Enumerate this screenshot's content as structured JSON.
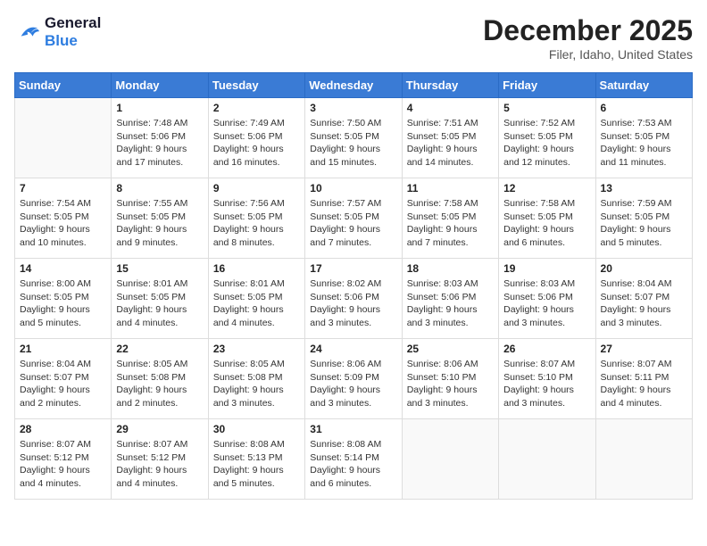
{
  "logo": {
    "line1": "General",
    "line2": "Blue"
  },
  "title": "December 2025",
  "location": "Filer, Idaho, United States",
  "weekdays": [
    "Sunday",
    "Monday",
    "Tuesday",
    "Wednesday",
    "Thursday",
    "Friday",
    "Saturday"
  ],
  "weeks": [
    [
      {
        "day": "",
        "sunrise": "",
        "sunset": "",
        "daylight": ""
      },
      {
        "day": "1",
        "sunrise": "Sunrise: 7:48 AM",
        "sunset": "Sunset: 5:06 PM",
        "daylight": "Daylight: 9 hours and 17 minutes."
      },
      {
        "day": "2",
        "sunrise": "Sunrise: 7:49 AM",
        "sunset": "Sunset: 5:06 PM",
        "daylight": "Daylight: 9 hours and 16 minutes."
      },
      {
        "day": "3",
        "sunrise": "Sunrise: 7:50 AM",
        "sunset": "Sunset: 5:05 PM",
        "daylight": "Daylight: 9 hours and 15 minutes."
      },
      {
        "day": "4",
        "sunrise": "Sunrise: 7:51 AM",
        "sunset": "Sunset: 5:05 PM",
        "daylight": "Daylight: 9 hours and 14 minutes."
      },
      {
        "day": "5",
        "sunrise": "Sunrise: 7:52 AM",
        "sunset": "Sunset: 5:05 PM",
        "daylight": "Daylight: 9 hours and 12 minutes."
      },
      {
        "day": "6",
        "sunrise": "Sunrise: 7:53 AM",
        "sunset": "Sunset: 5:05 PM",
        "daylight": "Daylight: 9 hours and 11 minutes."
      }
    ],
    [
      {
        "day": "7",
        "sunrise": "Sunrise: 7:54 AM",
        "sunset": "Sunset: 5:05 PM",
        "daylight": "Daylight: 9 hours and 10 minutes."
      },
      {
        "day": "8",
        "sunrise": "Sunrise: 7:55 AM",
        "sunset": "Sunset: 5:05 PM",
        "daylight": "Daylight: 9 hours and 9 minutes."
      },
      {
        "day": "9",
        "sunrise": "Sunrise: 7:56 AM",
        "sunset": "Sunset: 5:05 PM",
        "daylight": "Daylight: 9 hours and 8 minutes."
      },
      {
        "day": "10",
        "sunrise": "Sunrise: 7:57 AM",
        "sunset": "Sunset: 5:05 PM",
        "daylight": "Daylight: 9 hours and 7 minutes."
      },
      {
        "day": "11",
        "sunrise": "Sunrise: 7:58 AM",
        "sunset": "Sunset: 5:05 PM",
        "daylight": "Daylight: 9 hours and 7 minutes."
      },
      {
        "day": "12",
        "sunrise": "Sunrise: 7:58 AM",
        "sunset": "Sunset: 5:05 PM",
        "daylight": "Daylight: 9 hours and 6 minutes."
      },
      {
        "day": "13",
        "sunrise": "Sunrise: 7:59 AM",
        "sunset": "Sunset: 5:05 PM",
        "daylight": "Daylight: 9 hours and 5 minutes."
      }
    ],
    [
      {
        "day": "14",
        "sunrise": "Sunrise: 8:00 AM",
        "sunset": "Sunset: 5:05 PM",
        "daylight": "Daylight: 9 hours and 5 minutes."
      },
      {
        "day": "15",
        "sunrise": "Sunrise: 8:01 AM",
        "sunset": "Sunset: 5:05 PM",
        "daylight": "Daylight: 9 hours and 4 minutes."
      },
      {
        "day": "16",
        "sunrise": "Sunrise: 8:01 AM",
        "sunset": "Sunset: 5:05 PM",
        "daylight": "Daylight: 9 hours and 4 minutes."
      },
      {
        "day": "17",
        "sunrise": "Sunrise: 8:02 AM",
        "sunset": "Sunset: 5:06 PM",
        "daylight": "Daylight: 9 hours and 3 minutes."
      },
      {
        "day": "18",
        "sunrise": "Sunrise: 8:03 AM",
        "sunset": "Sunset: 5:06 PM",
        "daylight": "Daylight: 9 hours and 3 minutes."
      },
      {
        "day": "19",
        "sunrise": "Sunrise: 8:03 AM",
        "sunset": "Sunset: 5:06 PM",
        "daylight": "Daylight: 9 hours and 3 minutes."
      },
      {
        "day": "20",
        "sunrise": "Sunrise: 8:04 AM",
        "sunset": "Sunset: 5:07 PM",
        "daylight": "Daylight: 9 hours and 3 minutes."
      }
    ],
    [
      {
        "day": "21",
        "sunrise": "Sunrise: 8:04 AM",
        "sunset": "Sunset: 5:07 PM",
        "daylight": "Daylight: 9 hours and 2 minutes."
      },
      {
        "day": "22",
        "sunrise": "Sunrise: 8:05 AM",
        "sunset": "Sunset: 5:08 PM",
        "daylight": "Daylight: 9 hours and 2 minutes."
      },
      {
        "day": "23",
        "sunrise": "Sunrise: 8:05 AM",
        "sunset": "Sunset: 5:08 PM",
        "daylight": "Daylight: 9 hours and 3 minutes."
      },
      {
        "day": "24",
        "sunrise": "Sunrise: 8:06 AM",
        "sunset": "Sunset: 5:09 PM",
        "daylight": "Daylight: 9 hours and 3 minutes."
      },
      {
        "day": "25",
        "sunrise": "Sunrise: 8:06 AM",
        "sunset": "Sunset: 5:10 PM",
        "daylight": "Daylight: 9 hours and 3 minutes."
      },
      {
        "day": "26",
        "sunrise": "Sunrise: 8:07 AM",
        "sunset": "Sunset: 5:10 PM",
        "daylight": "Daylight: 9 hours and 3 minutes."
      },
      {
        "day": "27",
        "sunrise": "Sunrise: 8:07 AM",
        "sunset": "Sunset: 5:11 PM",
        "daylight": "Daylight: 9 hours and 4 minutes."
      }
    ],
    [
      {
        "day": "28",
        "sunrise": "Sunrise: 8:07 AM",
        "sunset": "Sunset: 5:12 PM",
        "daylight": "Daylight: 9 hours and 4 minutes."
      },
      {
        "day": "29",
        "sunrise": "Sunrise: 8:07 AM",
        "sunset": "Sunset: 5:12 PM",
        "daylight": "Daylight: 9 hours and 4 minutes."
      },
      {
        "day": "30",
        "sunrise": "Sunrise: 8:08 AM",
        "sunset": "Sunset: 5:13 PM",
        "daylight": "Daylight: 9 hours and 5 minutes."
      },
      {
        "day": "31",
        "sunrise": "Sunrise: 8:08 AM",
        "sunset": "Sunset: 5:14 PM",
        "daylight": "Daylight: 9 hours and 6 minutes."
      },
      {
        "day": "",
        "sunrise": "",
        "sunset": "",
        "daylight": ""
      },
      {
        "day": "",
        "sunrise": "",
        "sunset": "",
        "daylight": ""
      },
      {
        "day": "",
        "sunrise": "",
        "sunset": "",
        "daylight": ""
      }
    ]
  ]
}
